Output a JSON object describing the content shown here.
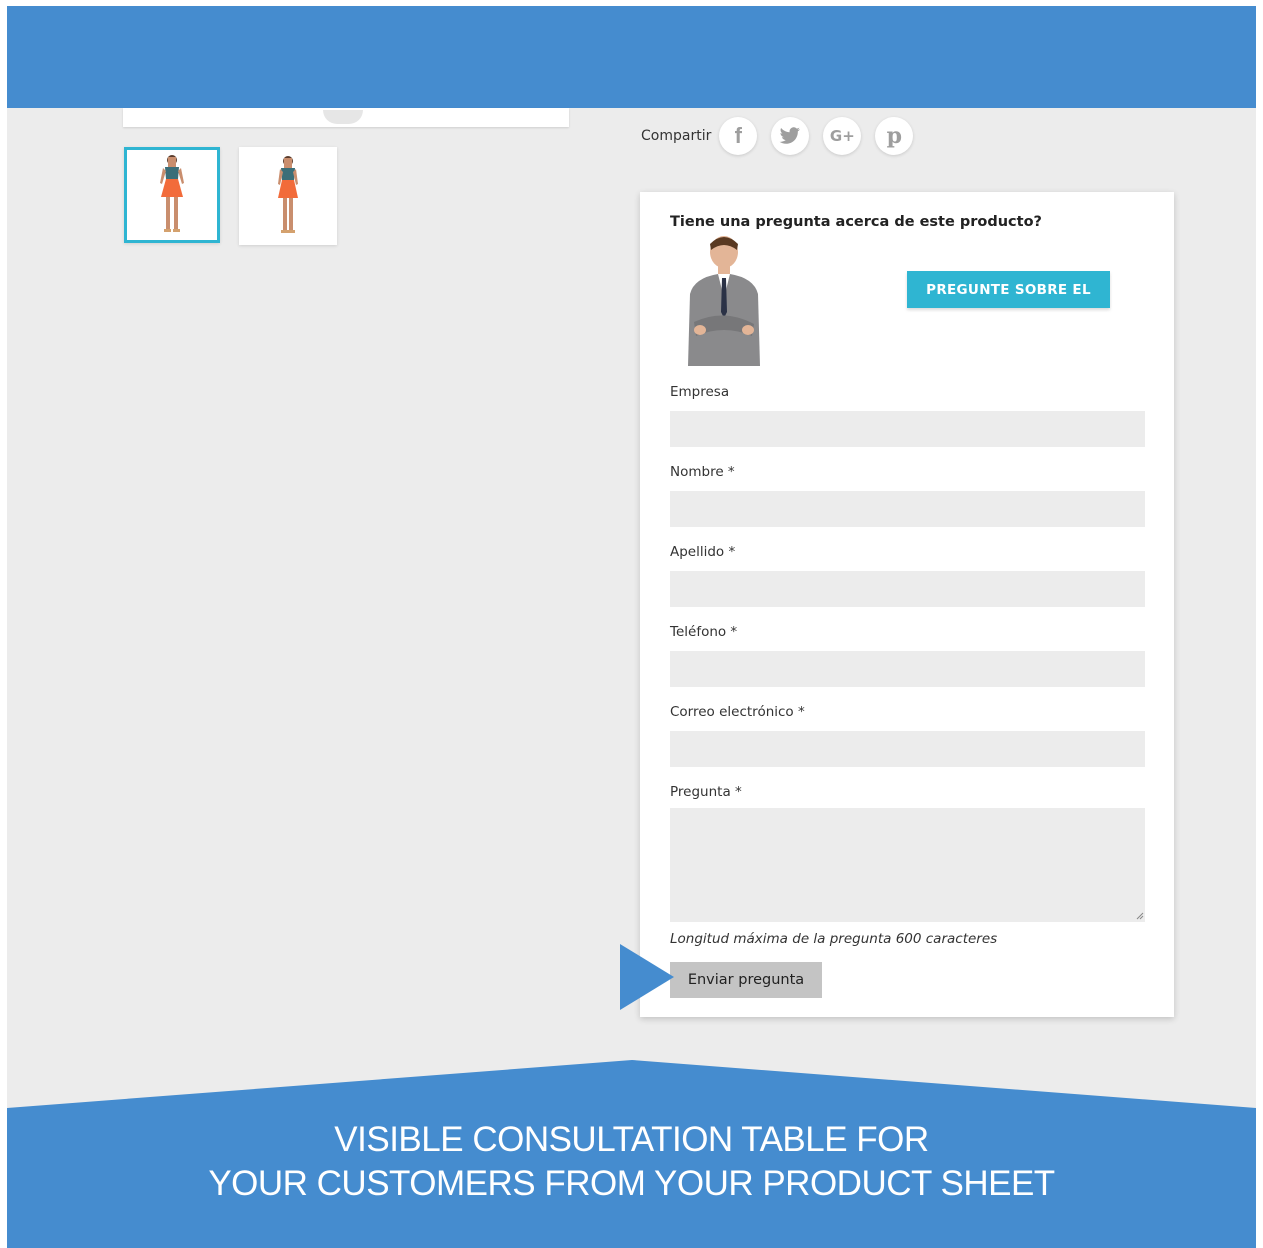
{
  "share": {
    "label": "Compartir",
    "networks": [
      {
        "name": "facebook",
        "icon": "facebook-icon",
        "glyph": "f"
      },
      {
        "name": "twitter",
        "icon": "twitter-icon"
      },
      {
        "name": "google-plus",
        "icon": "google-plus-icon",
        "glyph": "G+"
      },
      {
        "name": "pinterest",
        "icon": "pinterest-icon",
        "glyph": "p"
      }
    ]
  },
  "thumbnails": {
    "count": 2,
    "selected": 1
  },
  "question_form": {
    "title": "Tiene una pregunta acerca de este producto?",
    "ask_button": "PREGUNTE SOBRE EL",
    "fields": [
      {
        "label": "Empresa",
        "value": ""
      },
      {
        "label": "Nombre *",
        "value": ""
      },
      {
        "label": "Apellido *",
        "value": ""
      },
      {
        "label": "Teléfono *",
        "value": ""
      },
      {
        "label": "Correo electrónico *",
        "value": ""
      }
    ],
    "question_label": "Pregunta *",
    "question_value": "",
    "hint": "Longitud máxima de la pregunta 600 caracteres",
    "submit_button": "Enviar pregunta"
  },
  "banner": {
    "line1": "VISIBLE CONSULTATION TABLE FOR",
    "line2": "YOUR CUSTOMERS FROM YOUR PRODUCT SHEET"
  },
  "colors": {
    "brand_blue": "#458ccf",
    "accent_cyan": "#2fb5d2",
    "field_bg": "#ececec",
    "submit_bg": "#c4c4c4"
  }
}
